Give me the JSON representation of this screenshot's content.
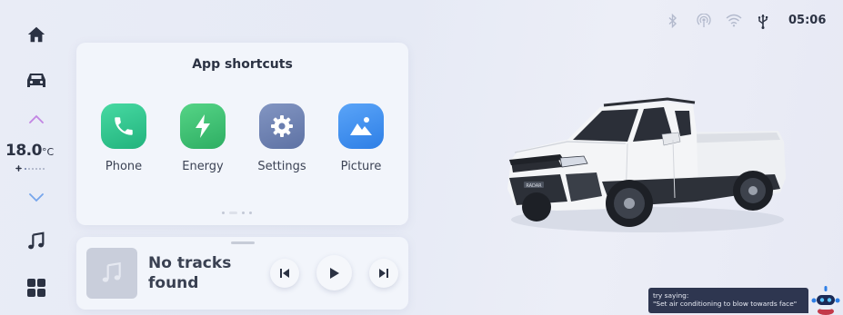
{
  "status": {
    "time": "05:06"
  },
  "climate": {
    "temperature": "18.0",
    "unit": "°C"
  },
  "shortcuts": {
    "title": "App shortcuts",
    "apps": [
      {
        "label": "Phone"
      },
      {
        "label": "Energy"
      },
      {
        "label": "Settings"
      },
      {
        "label": "Picture"
      }
    ]
  },
  "music": {
    "track_title": "No tracks found"
  },
  "voice": {
    "line1": "try saying:",
    "line2": "\"Set air conditioning to blow towards face\""
  },
  "car": {
    "badge": "RADAR"
  },
  "colors": {
    "phone_icon": "#31c88f",
    "energy_icon": "#3ec275",
    "settings_icon": "#6d81b1",
    "picture_icon": "#3d8ef0",
    "accent": "#7da8ee"
  }
}
